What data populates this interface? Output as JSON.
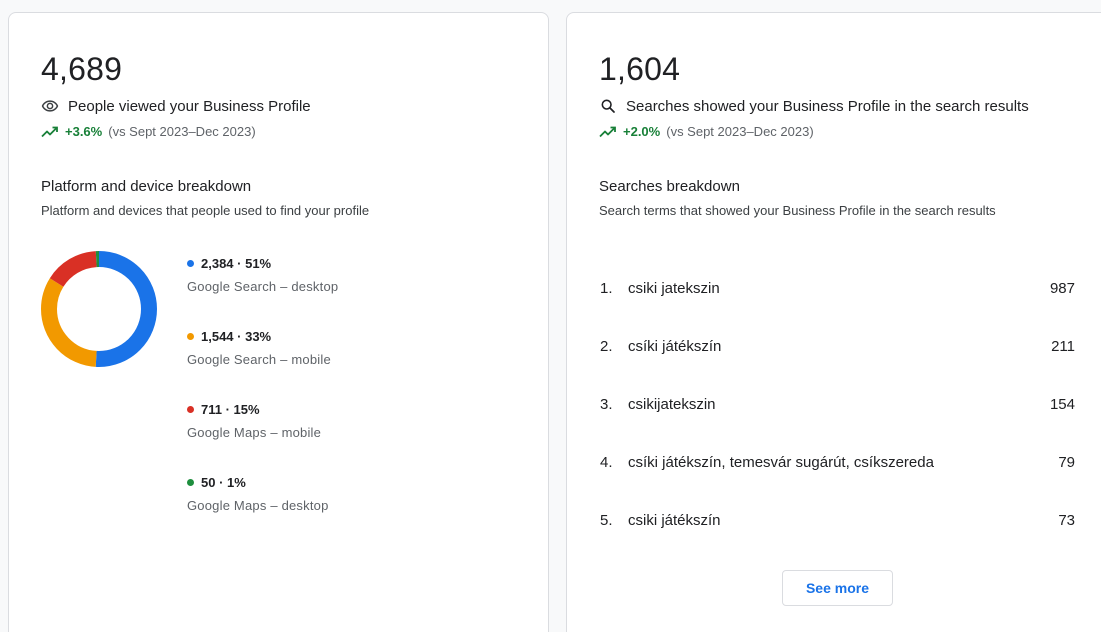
{
  "views_card": {
    "total": "4,689",
    "label": "People viewed your Business Profile",
    "trend_value": "+3.6%",
    "trend_period": "(vs Sept 2023–Dec 2023)",
    "section_title": "Platform and device breakdown",
    "section_subtitle": "Platform and devices that people used to find your profile",
    "breakdown": [
      {
        "value": "2,384 · 51%",
        "name": "Google Search – desktop",
        "color": "#1a73e8",
        "count": 2384
      },
      {
        "value": "1,544 · 33%",
        "name": "Google Search – mobile",
        "color": "#f29900",
        "count": 1544
      },
      {
        "value": "711 · 15%",
        "name": "Google Maps – mobile",
        "color": "#d93025",
        "count": 711
      },
      {
        "value": "50 · 1%",
        "name": "Google Maps – desktop",
        "color": "#1e8e3e",
        "count": 50
      }
    ]
  },
  "searches_card": {
    "total": "1,604",
    "label": "Searches showed your Business Profile in the search results",
    "trend_value": "+2.0%",
    "trend_period": "(vs Sept 2023–Dec 2023)",
    "section_title": "Searches breakdown",
    "section_subtitle": "Search terms that showed your Business Profile in the search results",
    "terms": [
      {
        "index": "1.",
        "term": "csiki jatekszin",
        "count": "987"
      },
      {
        "index": "2.",
        "term": "csíki játékszín",
        "count": "211"
      },
      {
        "index": "3.",
        "term": "csikijatekszin",
        "count": "154"
      },
      {
        "index": "4.",
        "term": "csíki játékszín, temesvár sugárút, csíkszereda",
        "count": "79"
      },
      {
        "index": "5.",
        "term": "csiki játékszín",
        "count": "73"
      }
    ],
    "see_more_label": "See more"
  },
  "icons": {
    "views": "eye-icon",
    "searches": "search-icon",
    "trend": "trending-up-icon"
  },
  "colors": {
    "trend_positive": "#188038",
    "link": "#1a73e8"
  }
}
